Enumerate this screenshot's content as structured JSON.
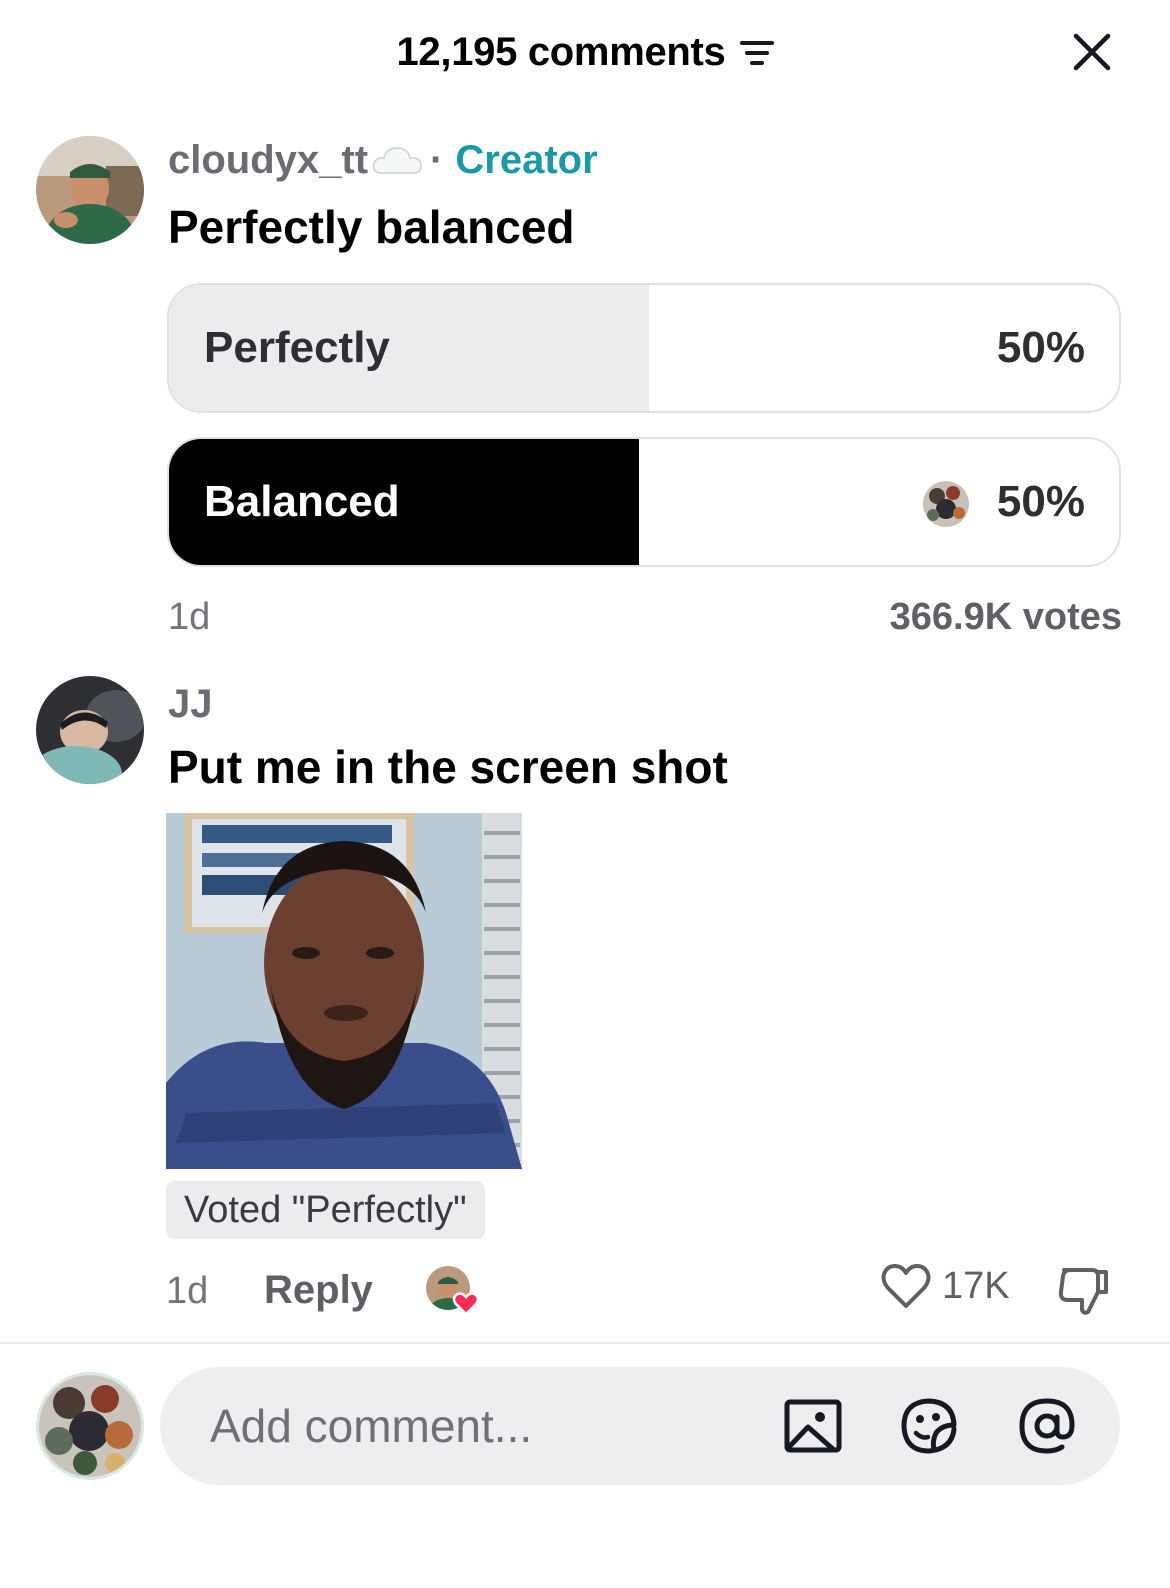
{
  "header": {
    "title": "12,195 comments",
    "filter_icon": "filter-icon",
    "close_icon": "close-icon"
  },
  "comments": [
    {
      "username": "cloudyx_tt",
      "username_emoji": "cloud-icon",
      "separator": "·",
      "role_tag": "Creator",
      "text": "Perfectly balanced",
      "poll": {
        "options": [
          {
            "label": "Perfectly",
            "percent_text": "50%",
            "fill_fraction": 0.505,
            "selected_by_viewer": false
          },
          {
            "label": "Balanced",
            "percent_text": "50%",
            "fill_fraction": 0.495,
            "selected_by_viewer": true
          }
        ],
        "votes": "366.9K votes"
      },
      "time": "1d"
    },
    {
      "username": "JJ",
      "text": "Put me in the screen shot",
      "badge": "Voted \"Perfectly\"",
      "time": "1d",
      "reply_label": "Reply",
      "like_count": "17K"
    }
  ],
  "composer": {
    "placeholder": "Add comment...",
    "icons": [
      "image-icon",
      "emoji-icon",
      "mention-icon"
    ]
  },
  "colors": {
    "creator_tag": "#1a9aa8",
    "poll_selected_fill": "#000000",
    "poll_unselected_fill": "#ececee",
    "heart_red": "#fe2c55"
  }
}
